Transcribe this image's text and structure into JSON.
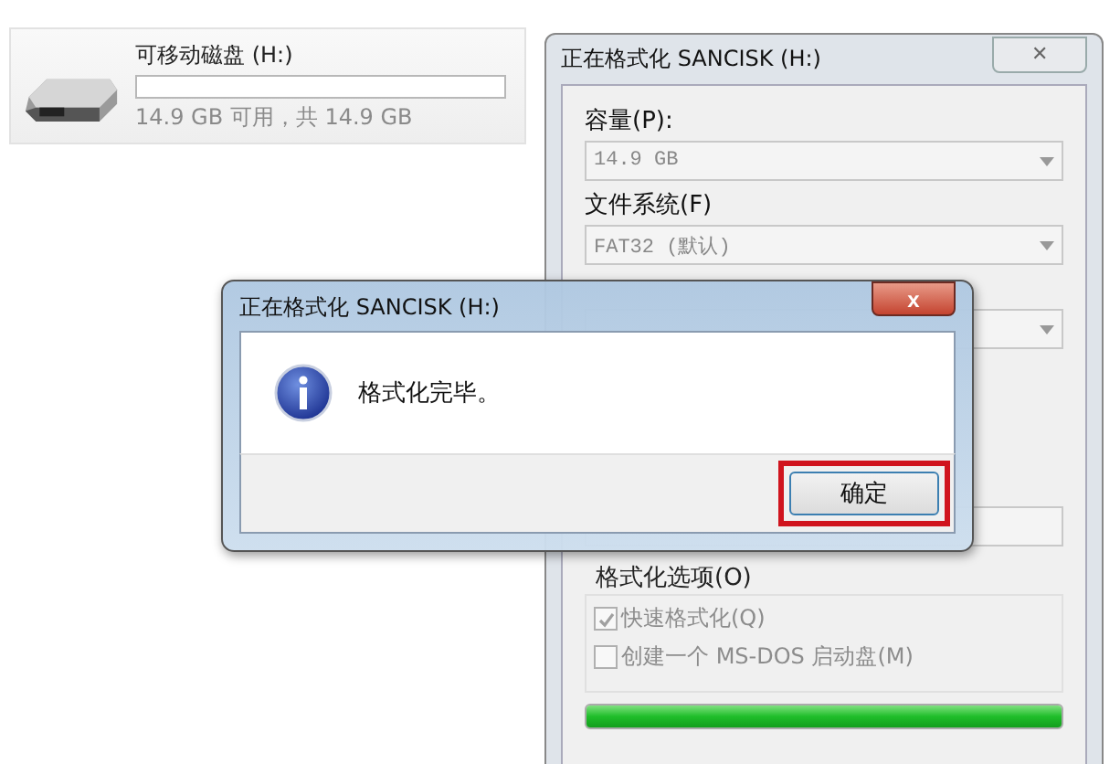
{
  "drive": {
    "name": "可移动磁盘 (H:)",
    "level": 0,
    "space": "14.9 GB 可用，共 14.9 GB"
  },
  "format_window": {
    "title": "正在格式化 SANCISK (H:)",
    "close": "✕",
    "fields": [
      {
        "kind": "combo",
        "label": "容量(P):",
        "value": "14.9 GB"
      },
      {
        "kind": "combo",
        "label": "文件系统(F)",
        "value": "FAT32 (默认)"
      },
      {
        "kind": "combo"
      },
      {
        "kind": "text"
      }
    ],
    "options_group": {
      "label": "格式化选项(O)",
      "options": [
        {
          "label": "快速格式化(Q)",
          "checked": true,
          "disabled": true
        },
        {
          "label": "创建一个 MS-DOS 启动盘(M)",
          "checked": false,
          "disabled": true
        }
      ]
    },
    "progress": {
      "level": 1
    }
  },
  "message_box": {
    "title": "正在格式化 SANCISK (H:)",
    "close": "x",
    "message": "格式化完毕。",
    "ok_button": {
      "label": "确定",
      "highlighted": true
    }
  }
}
